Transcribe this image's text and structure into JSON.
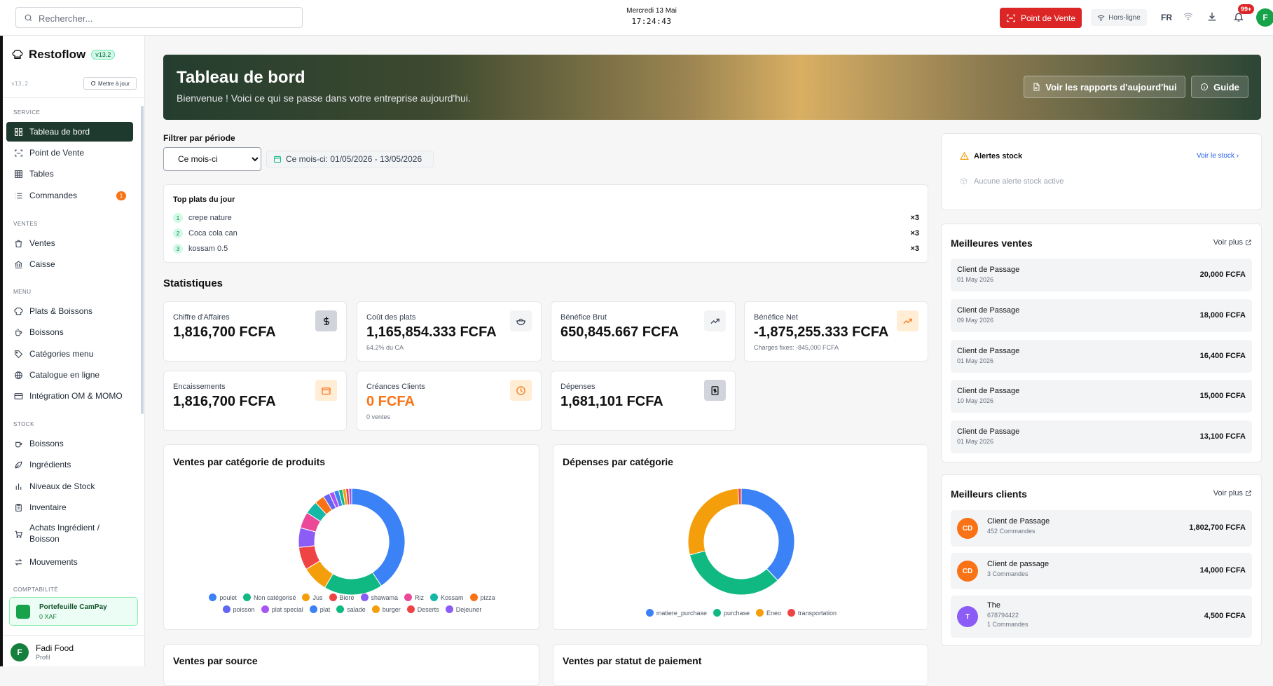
{
  "topbar": {
    "search_placeholder": "Rechercher...",
    "date": "Mercredi 13 Mai",
    "time": "17:24:43",
    "pos_button": "Point de Vente",
    "status": "Hors-ligne",
    "lang": "FR",
    "notif_badge": "99+",
    "avatar": "F"
  },
  "sidebar": {
    "app_name": "Restoflow",
    "version_badge": "v13.2",
    "version_small": "v13.2",
    "update_button": "Mettre à jour",
    "sections": {
      "service": "SERVICE",
      "ventes": "VENTES",
      "menu": "MENU",
      "stock": "STOCK",
      "compta": "COMPTABILITÉ"
    },
    "items": [
      "Tableau de bord",
      "Point de Vente",
      "Tables",
      "Commandes",
      "Ventes",
      "Caisse",
      "Plats & Boissons",
      "Boissons",
      "Catégories menu",
      "Catalogue en ligne",
      "Intégration OM & MOMO",
      "Boissons",
      "Ingrédients",
      "Niveaux de Stock",
      "Inventaire",
      "Achats Ingrédient / Boisson",
      "Mouvements"
    ],
    "commandes_count": "1",
    "wallet": {
      "title": "Portefeuille CamPay",
      "amount": "0 XAF"
    },
    "profile": {
      "initial": "F",
      "name": "Fadi Food",
      "role": "Profil"
    }
  },
  "banner": {
    "title": "Tableau de bord",
    "subtitle": "Bienvenue ! Voici ce qui se passe dans votre entreprise aujourd'hui.",
    "reports_button": "Voir les rapports d'aujourd'hui",
    "guide_button": "Guide"
  },
  "filter": {
    "label": "Filtrer par période",
    "selected": "Ce mois-ci",
    "range": "Ce mois-ci: 01/05/2026 - 13/05/2026"
  },
  "top_dishes": {
    "title": "Top plats du jour",
    "items": [
      {
        "rank": "1",
        "name": "crepe nature",
        "qty": "×3"
      },
      {
        "rank": "2",
        "name": "Coca cola can",
        "qty": "×3"
      },
      {
        "rank": "3",
        "name": "kossam 0.5",
        "qty": "×3"
      }
    ]
  },
  "stats": {
    "title": "Statistiques",
    "cards": [
      {
        "label": "Chiffre d'Affaires",
        "value": "1,816,700 FCFA",
        "sub": ""
      },
      {
        "label": "Coût des plats",
        "value": "1,165,854.333 FCFA",
        "sub": "64.2% du CA"
      },
      {
        "label": "Bénéfice Brut",
        "value": "650,845.667 FCFA",
        "sub": ""
      },
      {
        "label": "Bénéfice Net",
        "value": "-1,875,255.333 FCFA",
        "sub": "Charges fixes: -845,000 FCFA"
      },
      {
        "label": "Encaissements",
        "value": "1,816,700 FCFA",
        "sub": ""
      },
      {
        "label": "Créances Clients",
        "value": "0 FCFA",
        "sub": "0 ventes"
      },
      {
        "label": "Dépenses",
        "value": "1,681,101 FCFA",
        "sub": ""
      }
    ]
  },
  "charts_titles": {
    "sales_by_category": "Ventes par catégorie de produits",
    "expenses_by_category": "Dépenses par catégorie",
    "sales_by_source": "Ventes par source",
    "sales_by_payment": "Ventes par statut de paiement"
  },
  "chart_data": [
    {
      "type": "pie",
      "title": "Ventes par catégorie de produits",
      "categories": [
        "poulet",
        "Non catégorisé",
        "Jus",
        "Biere",
        "shawama",
        "Riz",
        "Kossam",
        "pizza",
        "poisson",
        "plat special",
        "plat",
        "salade",
        "burger",
        "Deserts",
        "Dejeuner"
      ],
      "values": [
        41,
        18,
        8,
        7,
        6,
        5,
        4,
        3,
        2,
        1.5,
        1.5,
        1.2,
        1,
        0.9,
        0.9
      ],
      "colors": [
        "#3b82f6",
        "#10b981",
        "#f59e0b",
        "#ef4444",
        "#8b5cf6",
        "#ec4899",
        "#14b8a6",
        "#f97316",
        "#6366f1",
        "#a855f7",
        "#3b82f6",
        "#10b981",
        "#f59e0b",
        "#ef4444",
        "#8b5cf6"
      ]
    },
    {
      "type": "pie",
      "title": "Dépenses par catégorie",
      "categories": [
        "matiere_purchase",
        "purchase",
        "Eneo",
        "transportation"
      ],
      "values": [
        38,
        33,
        28,
        1
      ],
      "colors": [
        "#3b82f6",
        "#10b981",
        "#f59e0b",
        "#ef4444"
      ]
    }
  ],
  "stock_alerts": {
    "title": "Alertes stock",
    "link": "Voir le stock",
    "empty": "Aucune alerte stock active"
  },
  "best_sales": {
    "title": "Meilleures ventes",
    "link": "Voir plus",
    "rows": [
      {
        "name": "Client de Passage",
        "date": "01 May 2026",
        "amount": "20,000 FCFA"
      },
      {
        "name": "Client de Passage",
        "date": "09 May 2026",
        "amount": "18,000 FCFA"
      },
      {
        "name": "Client de Passage",
        "date": "01 May 2026",
        "amount": "16,400 FCFA"
      },
      {
        "name": "Client de Passage",
        "date": "10 May 2026",
        "amount": "15,000 FCFA"
      },
      {
        "name": "Client de Passage",
        "date": "01 May 2026",
        "amount": "13,100 FCFA"
      }
    ]
  },
  "best_clients": {
    "title": "Meilleurs clients",
    "link": "Voir plus",
    "rows": [
      {
        "initials": "CD",
        "name": "Client de Passage",
        "phone": "",
        "orders": "452 Commandes",
        "amount": "1,802,700 FCFA",
        "color": "#f97316"
      },
      {
        "initials": "CD",
        "name": "Client de passage",
        "phone": "",
        "orders": "3 Commandes",
        "amount": "14,000 FCFA",
        "color": "#f97316"
      },
      {
        "initials": "T",
        "name": "The",
        "phone": "678794422",
        "orders": "1 Commandes",
        "amount": "4,500 FCFA",
        "color": "#8b5cf6"
      }
    ]
  }
}
